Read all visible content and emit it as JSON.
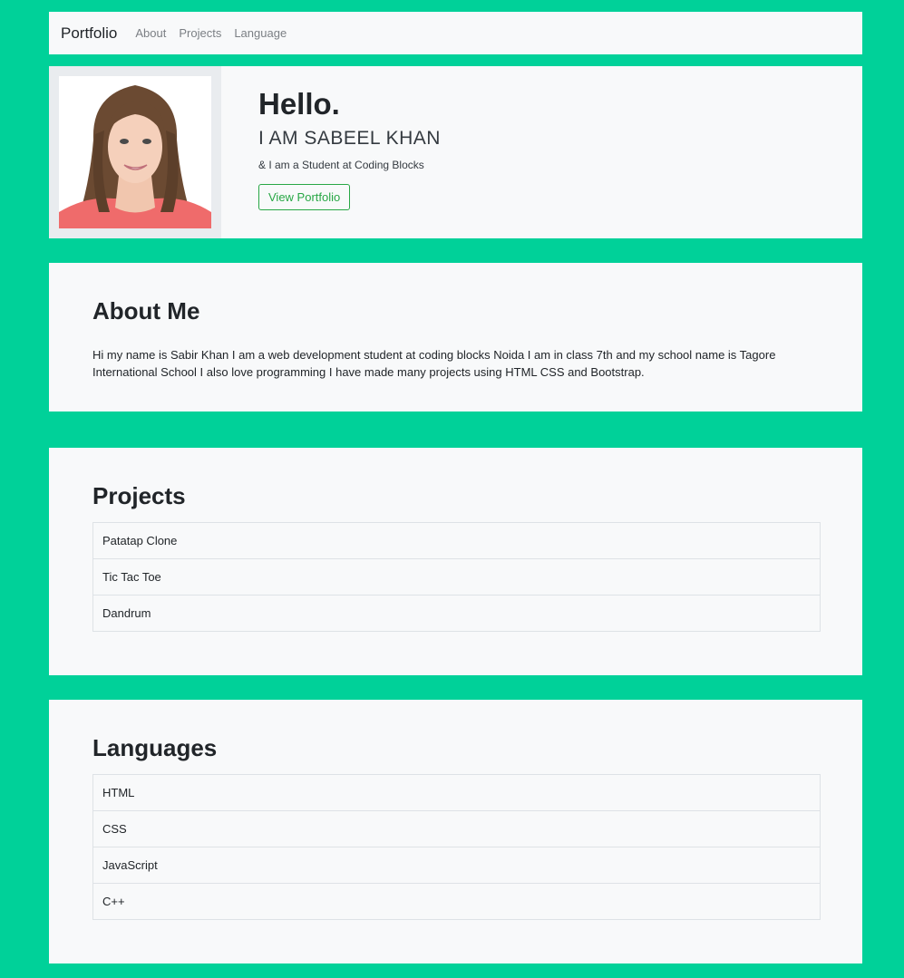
{
  "navbar": {
    "brand": "Portfolio",
    "links": [
      "About",
      "Projects",
      "Language"
    ]
  },
  "hero": {
    "greeting": "Hello.",
    "name_line": "I AM SABEEL KHAN",
    "subtitle": "& I am a Student at Coding Blocks",
    "button_label": "View Portfolio"
  },
  "about": {
    "title": "About Me",
    "text": "Hi my name is Sabir Khan I am a web development student at coding blocks Noida I am in class 7th and my school name is Tagore International School I also love programming I have made many projects using HTML CSS and Bootstrap."
  },
  "projects": {
    "title": "Projects",
    "items": [
      "Patatap Clone",
      "Tic Tac Toe",
      "Dandrum"
    ]
  },
  "languages": {
    "title": "Languages",
    "items": [
      "HTML",
      "CSS",
      "JavaScript",
      "C++"
    ]
  },
  "colors": {
    "background": "#00d199",
    "card": "#f8f9fa",
    "button_accent": "#28a745"
  }
}
